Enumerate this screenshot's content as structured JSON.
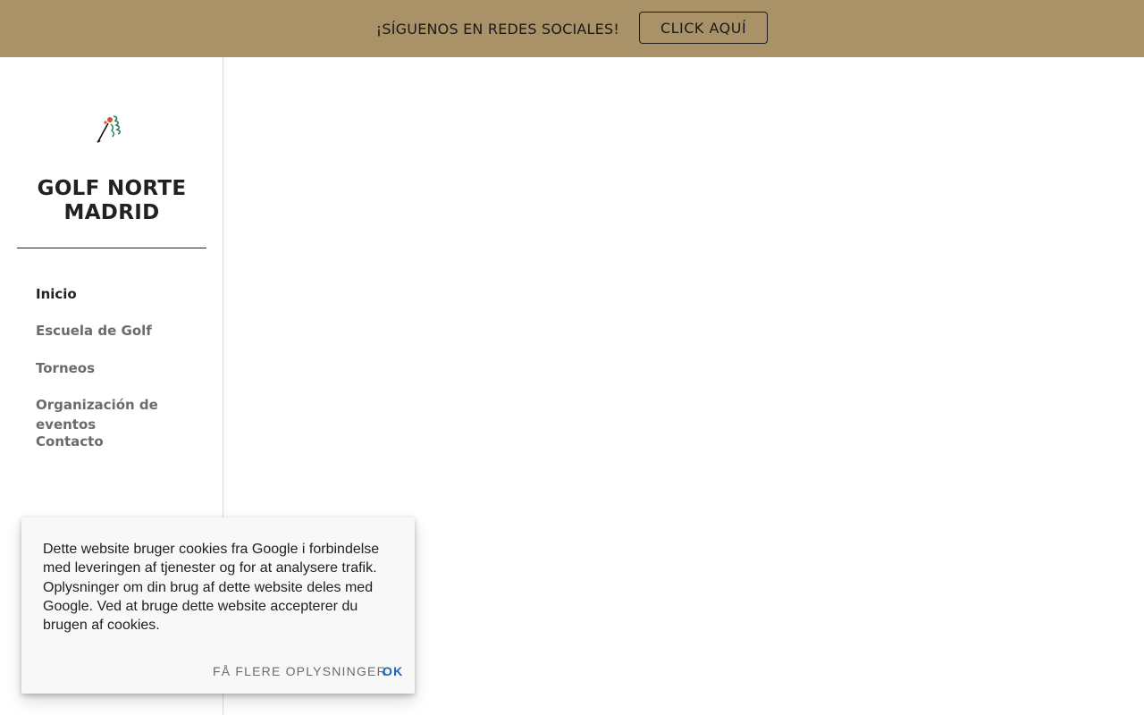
{
  "banner": {
    "text": "¡SÍGUENOS EN REDES SOCIALES!",
    "button_label": "CLICK AQUÍ"
  },
  "sidebar": {
    "logo_icon": "golf-player-icon",
    "site_title": "GOLF NORTE MADRID",
    "nav_items": [
      {
        "label": "Inicio",
        "active": true
      },
      {
        "label": "Escuela de Golf",
        "active": false
      },
      {
        "label": "Torneos",
        "active": false
      },
      {
        "label": "Organización de eventos",
        "active": false
      },
      {
        "label": "Contacto",
        "active": false
      }
    ]
  },
  "cookie_notice": {
    "text": "Dette website bruger cookies fra Google i forbindelse med leveringen af tjenester og for at analysere trafik. Oplysninger om din brug af dette website deles med Google. Ved at bruge dette website accepterer du brugen af cookies.",
    "more_info_label": "FÅ FLERE OPLYSNINGER",
    "ok_label": "OK"
  },
  "colors": {
    "banner_bg": "#a99268",
    "accent_link": "#1a64c8",
    "text_dark": "#212121",
    "text_muted": "#6b6b6b"
  }
}
